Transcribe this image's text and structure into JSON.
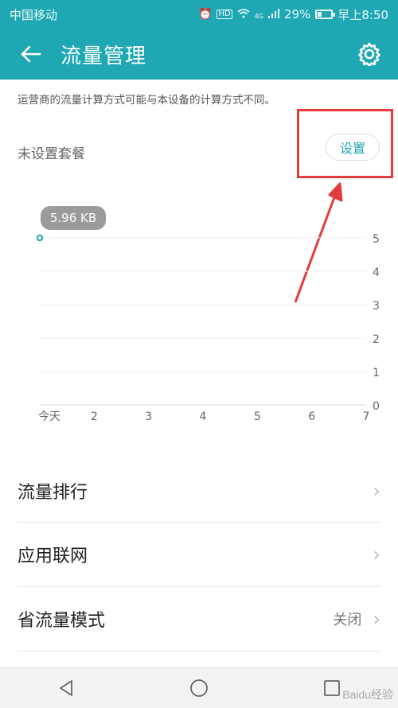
{
  "status_bar": {
    "carrier": "中国移动",
    "network": "4G",
    "battery_percent": "29%",
    "battery_level": 0.29,
    "time": "早上8:50",
    "icons": [
      "alarm-icon",
      "hd-icon",
      "wifi-icon",
      "signal-icon",
      "battery-icon"
    ]
  },
  "app_bar": {
    "title": "流量管理",
    "back_icon": "back-arrow-icon",
    "settings_icon": "gear-icon"
  },
  "notice": "运营商的流量计算方式可能与本设备的计算方式不同。",
  "plan": {
    "label": "未设置套餐",
    "button": "设置"
  },
  "chart_data": {
    "type": "line",
    "x_ticks": [
      "今天",
      "2",
      "3",
      "4",
      "5",
      "6",
      "7"
    ],
    "y_ticks": [
      "0",
      "1",
      "2",
      "3",
      "4",
      "5"
    ],
    "ylim": [
      0,
      5
    ],
    "series": [
      {
        "values": [
          5
        ]
      }
    ],
    "annotation": "5.96 KB",
    "accent": "#1fa8b3"
  },
  "menu": [
    {
      "label": "流量排行",
      "value": ""
    },
    {
      "label": "应用联网",
      "value": ""
    },
    {
      "label": "省流量模式",
      "value": "关闭"
    }
  ],
  "nav": {
    "icons": [
      "back-triangle-icon",
      "home-circle-icon",
      "recents-square-icon"
    ]
  },
  "watermark": "Baidu经验",
  "colors": {
    "brand": "#1fa8b3",
    "highlight": "#e23c3c"
  }
}
